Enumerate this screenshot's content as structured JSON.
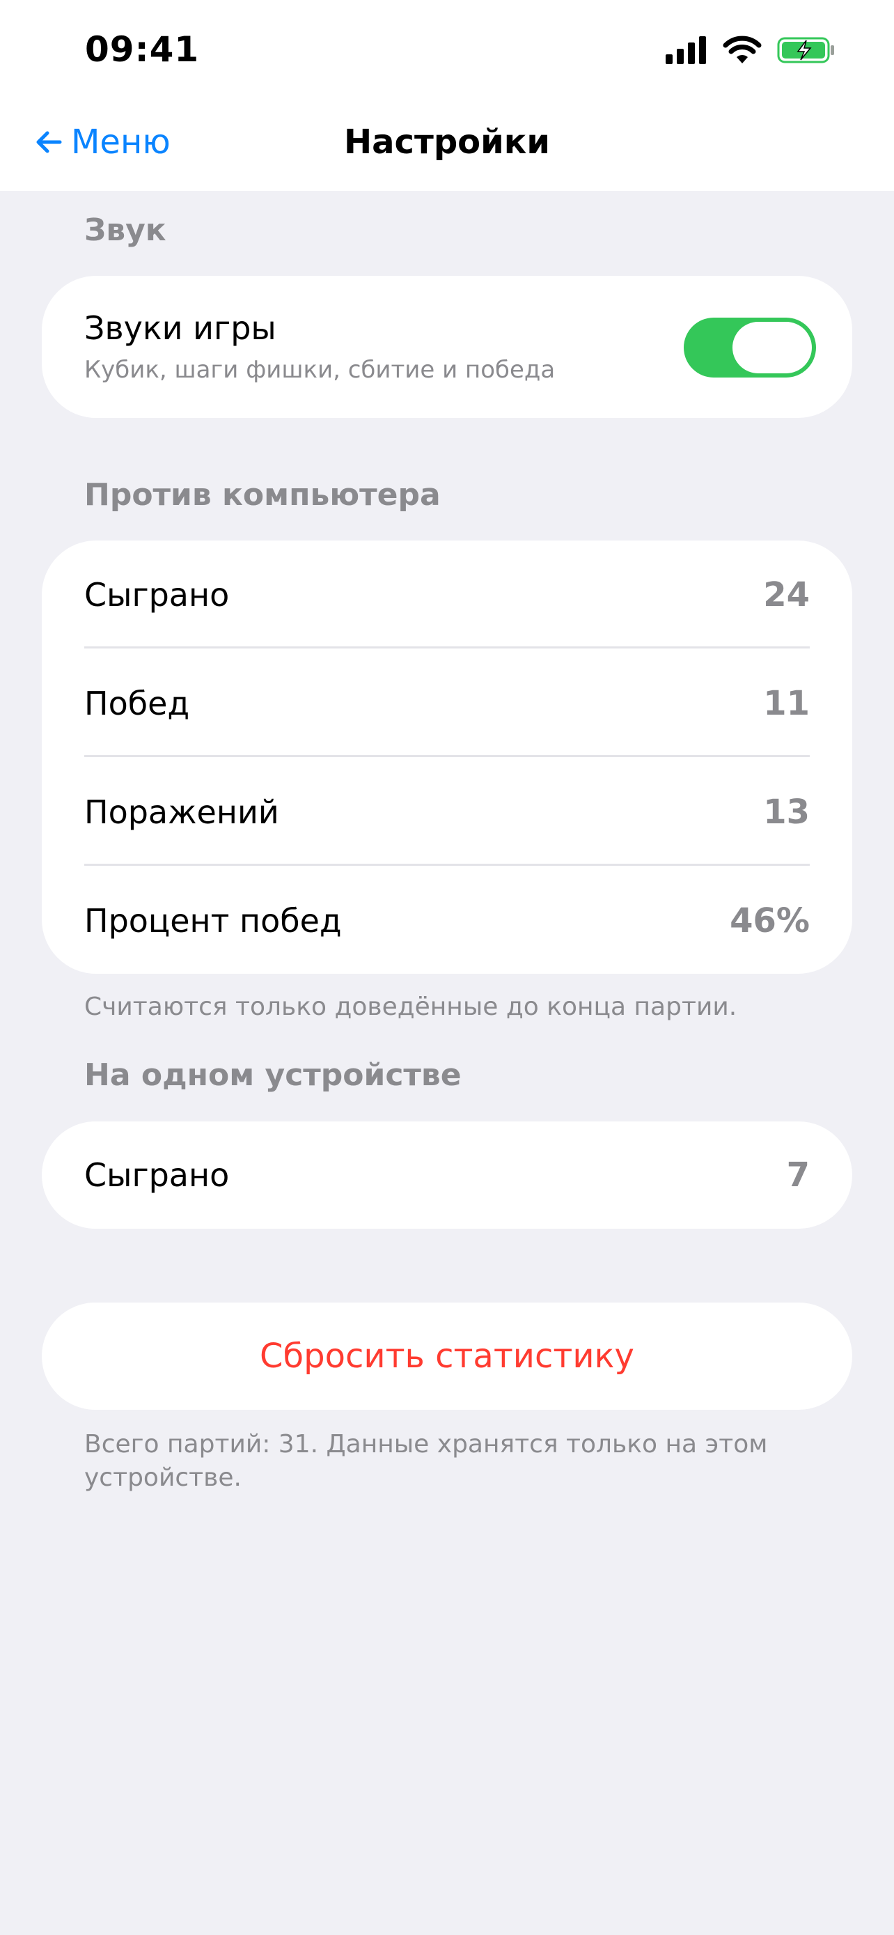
{
  "status_bar": {
    "time": "09:41"
  },
  "nav": {
    "back_label": "Меню",
    "title": "Настройки"
  },
  "sound_section": {
    "header": "Звук",
    "item_title": "Звуки игры",
    "item_subtitle": "Кубик, шаги фишки, сбитие и победа",
    "toggle_on": true,
    "toggle_color": "#34c759"
  },
  "vs_computer": {
    "header": "Против компьютера",
    "rows": [
      {
        "label": "Сыграно",
        "value": "24"
      },
      {
        "label": "Побед",
        "value": "11"
      },
      {
        "label": "Поражений",
        "value": "13"
      },
      {
        "label": "Процент побед",
        "value": "46%"
      }
    ],
    "footnote": "Считаются только доведённые до конца партии."
  },
  "same_device": {
    "header": "На одном устройстве",
    "rows": [
      {
        "label": "Сыграно",
        "value": "7"
      }
    ]
  },
  "reset": {
    "label": "Сбросить статистику",
    "color": "#ff3b30"
  },
  "footer_note": "Всего партий: 31. Данные хранятся только на этом устройстве.",
  "colors": {
    "accent": "#0a84ff",
    "background": "#f0f0f5",
    "battery": "#34c759"
  }
}
